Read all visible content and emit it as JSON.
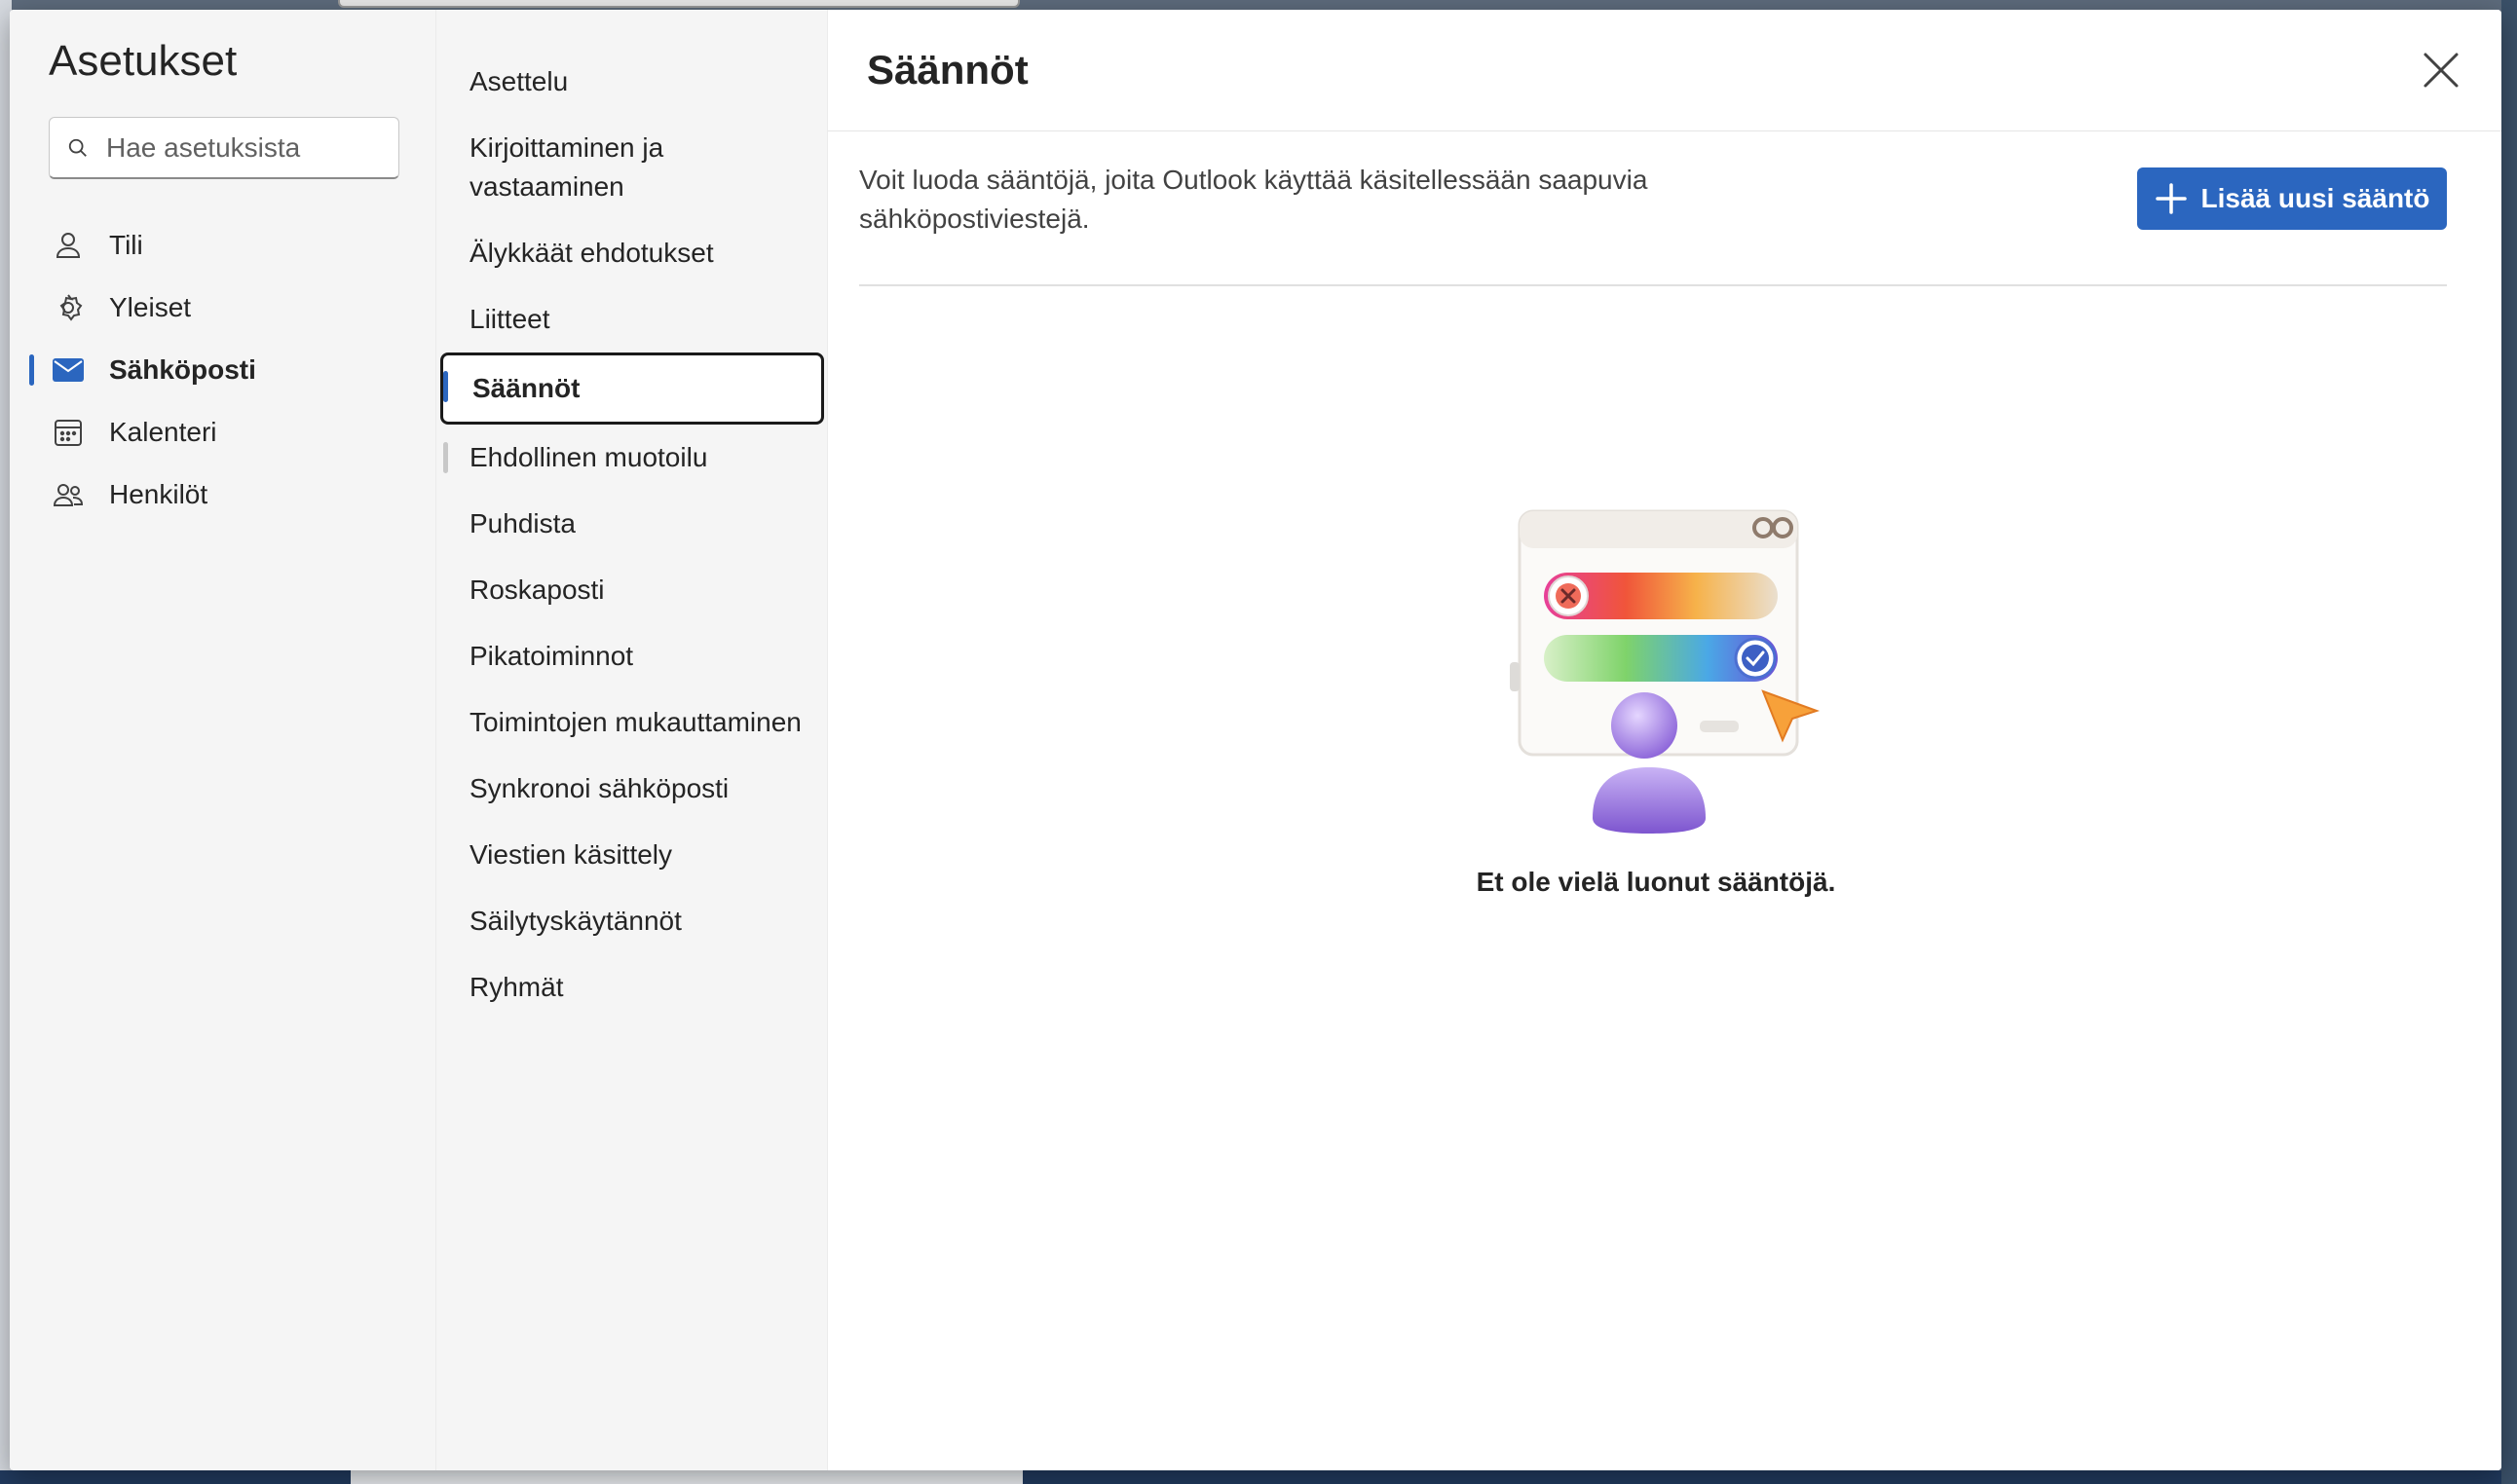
{
  "dialog": {
    "title": "Asetukset",
    "search": {
      "placeholder": "Hae asetuksista",
      "value": ""
    }
  },
  "nav_primary": [
    {
      "label": "Tili",
      "icon": "person-icon",
      "active": false
    },
    {
      "label": "Yleiset",
      "icon": "gear-icon",
      "active": false
    },
    {
      "label": "Sähköposti",
      "icon": "mail-icon",
      "active": true
    },
    {
      "label": "Kalenteri",
      "icon": "calendar-icon",
      "active": false
    },
    {
      "label": "Henkilöt",
      "icon": "people-icon",
      "active": false
    }
  ],
  "nav_secondary": [
    {
      "label": "Asettelu"
    },
    {
      "label": "Kirjoittaminen ja vastaaminen"
    },
    {
      "label": "Älykkäät ehdotukset"
    },
    {
      "label": "Liitteet"
    },
    {
      "label": "Säännöt",
      "selected": true
    },
    {
      "label": "Ehdollinen muotoilu"
    },
    {
      "label": "Puhdista"
    },
    {
      "label": "Roskaposti"
    },
    {
      "label": "Pikatoiminnot"
    },
    {
      "label": "Toimintojen mukauttaminen"
    },
    {
      "label": "Synkronoi sähköposti"
    },
    {
      "label": "Viestien käsittely"
    },
    {
      "label": "Säilytyskäytännöt"
    },
    {
      "label": "Ryhmät"
    }
  ],
  "content": {
    "title": "Säännöt",
    "description": "Voit luoda sääntöjä, joita Outlook käyttää käsitellessään saapuvia sähköpostiviestejä.",
    "add_button_label": "Lisää uusi sääntö",
    "empty_state": "Et ole vielä luonut sääntöjä."
  },
  "colors": {
    "accent": "#2b66bf",
    "text": "#242424",
    "sidebar_bg": "#f5f5f5"
  }
}
